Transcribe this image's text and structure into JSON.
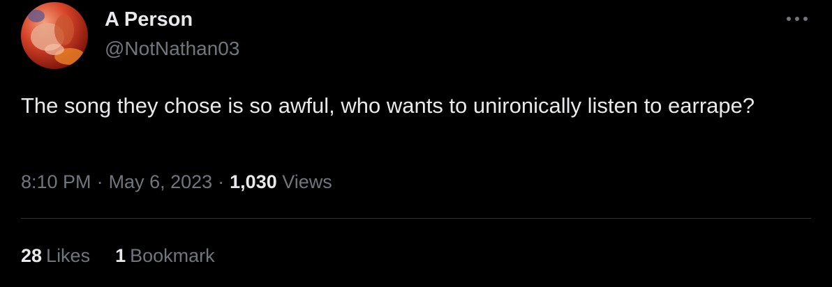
{
  "colors": {
    "background": "#000000",
    "primary_text": "#e7e9ea",
    "secondary_text": "#71767b",
    "divider": "#2f3336"
  },
  "author": {
    "display_name": "A Person",
    "handle": "@NotNathan03",
    "avatar_icon": "avatar-photo"
  },
  "menu": {
    "icon": "more-horizontal-icon",
    "glyph": "···"
  },
  "tweet": {
    "text": "The song they chose is so awful, who wants to unironically listen to earrape?"
  },
  "meta": {
    "time": "8:10 PM",
    "separator": "·",
    "date": "May 6, 2023",
    "views_count": "1,030",
    "views_label": "Views"
  },
  "stats": {
    "likes_count": "28",
    "likes_label": "Likes",
    "bookmarks_count": "1",
    "bookmarks_label": "Bookmark"
  }
}
